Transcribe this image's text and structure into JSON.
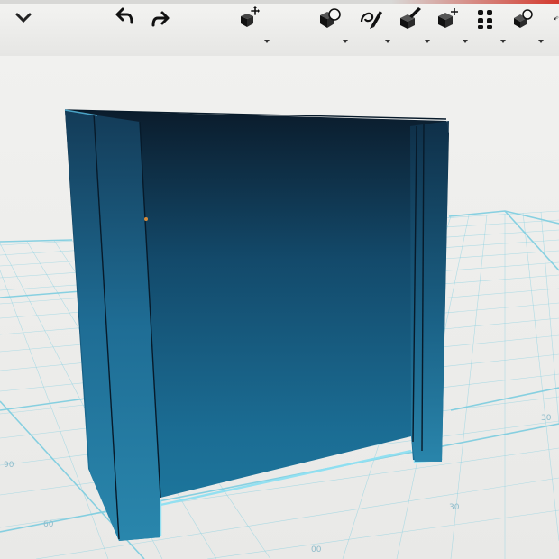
{
  "toolbar": {
    "buttons": [
      {
        "id": "menu",
        "icon": "chevron-down-icon"
      },
      {
        "id": "undo",
        "icon": "undo-arrow-icon"
      },
      {
        "id": "redo",
        "icon": "redo-arrow-icon"
      },
      {
        "id": "move",
        "icon": "move-object-icon"
      },
      {
        "id": "primitives",
        "icon": "primitive-cube-icon"
      },
      {
        "id": "sketch",
        "icon": "sketch-pencil-icon"
      },
      {
        "id": "construct",
        "icon": "construct-brush-icon"
      },
      {
        "id": "modify",
        "icon": "modify-cube-icon"
      },
      {
        "id": "pattern",
        "icon": "pattern-grid-icon"
      },
      {
        "id": "group",
        "icon": "group-cube-icon"
      },
      {
        "id": "snap",
        "icon": "snap-icon"
      }
    ]
  },
  "viewport": {
    "model": "rectangular-frame-solid",
    "model_color": "#1e6d96",
    "grid_color": "#6fc6dc",
    "background_color": "#ececea",
    "grid_labels": [
      "90",
      "60",
      "30",
      "00",
      "30"
    ]
  }
}
